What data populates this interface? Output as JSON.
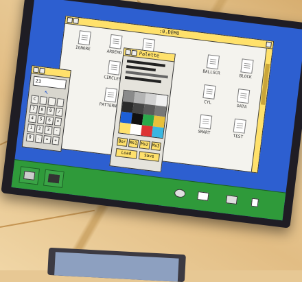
{
  "filer": {
    "title": ":0.DEMO",
    "files": [
      {
        "name": "IGNORE"
      },
      {
        "name": "ARDEMO"
      },
      {
        "name": ""
      },
      {
        "name": "CIRCLES"
      },
      {
        "name": "PATTERNS"
      },
      {
        "name": "BALLSCR"
      },
      {
        "name": "BLOCK"
      },
      {
        "name": "CYL"
      },
      {
        "name": "DATA"
      },
      {
        "name": "SMART"
      },
      {
        "name": "TEST"
      }
    ]
  },
  "palette": {
    "title": "Palette",
    "buttons": [
      "Bor",
      "Ms1",
      "Ms2",
      "Ms3"
    ],
    "actions": [
      "Load",
      "Save"
    ],
    "colors": [
      "#8a8a8a",
      "#b4b4b4",
      "#d2d2d2",
      "#f0f0f0",
      "#2a2a2a",
      "#444444",
      "#5a5a5a",
      "#777777",
      "#1d5fd6",
      "#111111",
      "#2aa94a",
      "#e8c03a",
      "#ffe16b",
      "#ffffff",
      "#d33",
      "#3ab6e0"
    ]
  },
  "calculator": {
    "display": "23",
    "keys": [
      "C",
      "",
      "",
      "",
      "7",
      "8",
      "9",
      "/",
      "4",
      "5",
      "6",
      "×",
      "1",
      "2",
      "3",
      "-",
      "0",
      ".",
      "=",
      "+"
    ]
  },
  "iconbar": {
    "icons": [
      "disc-drive-icon",
      "floppy-icon",
      "palette-icon",
      "doc-icon",
      "printer-icon",
      "switcher-icon"
    ]
  }
}
